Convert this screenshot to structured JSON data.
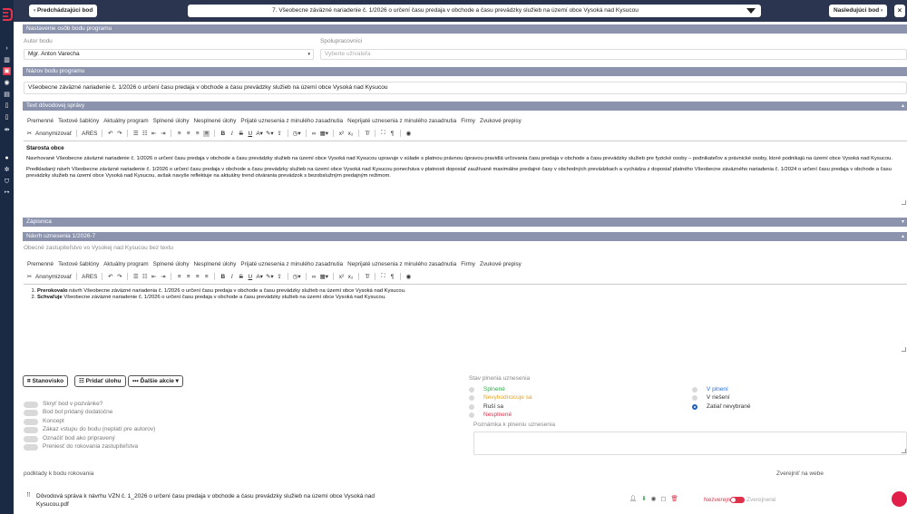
{
  "colors": {
    "sidebar_bg": "#1b2a44",
    "topbar_bg": "#2b3550",
    "section_header": "#8b93ad",
    "accent_red": "#e8334a",
    "radio_selected": "#1f5fbf",
    "fulfilled_green": "#33a84a",
    "partial_orange": "#e6a326",
    "unfulfilled_red": "#e0304a",
    "pending_blue": "#2a6fdb"
  },
  "topbar": {
    "prev_label": "‹ Predchádzajúci bod",
    "title": "7. Všeobecne záväzné nariadenie č. 1/2026 o určení času predaja v obchode a času prevádzky služieb na území obce Vysoká nad Kysucou",
    "next_label": "Nasledujúci bod ›",
    "close_label": "×"
  },
  "sidebar": {
    "icons": [
      "chevron-right-icon",
      "table-icon",
      "users-icon",
      "eye-icon",
      "calendar-icon",
      "document-icon",
      "document-icon",
      "bar-chart-icon",
      "people-icon",
      "user-icon",
      "gear-icon",
      "shield-icon",
      "logout-icon"
    ]
  },
  "settings": {
    "header": "Nastavenie osôb bodu programu",
    "author_label": "Autor bodu",
    "author_value": "Mgr. Anton Varecha",
    "collab_label": "Spolupracovníci",
    "collab_placeholder": "Vyberte užívateľa"
  },
  "name_section": {
    "header": "Názov bodu programu",
    "value": "Všeobecne záväzné nariadenie č. 1/2026 o určení času predaja v obchode a času prevádzky služieb na území obce Vysoká nad Kysucou"
  },
  "editor_menu": [
    "Premenné",
    "Textové šablóny",
    "Aktuálny program",
    "Splnené úlohy",
    "Nesplnené úlohy",
    "Prijaté uznesenia z minulého zasadnutia",
    "Neprijaté uznesenia z minulého zasadnutia",
    "Firmy",
    "Zvukové prepisy"
  ],
  "editor_toolbar": {
    "anonymize": "Anonymizovať",
    "ares": "ARES"
  },
  "report": {
    "header": "Text dôvodovej správy",
    "heading": "Starosta obce",
    "p1": "Navrhované Všeobecne záväzné nariadenie č. 1/2026 o určení času predaja v obchode a času prevádzky služieb na území obce Vysoká nad Kysucou upravuje v súlade s platnou právnou úpravou pravidlá určovania času predaja v obchode a času prevádzky služieb pre fyzické osoby – podnikateľov a právnické osoby, ktoré podnikajú na území obce Vysoká nad Kysucou.",
    "p2": "Predkladaný návrh Všeobecne záväzné nariadenie č. 1/2026 o určení času predaja v obchode a času prevádzky služieb na území obce Vysoká nad Kysucou ponecháva v platnosti doposiaľ zaužívané maximálne predajné časy v obchodných prevádzkach a vychádza z doposiaľ platného Všeobecne záväzného nariadenia č. 1/2024 o určení času predaja v obchode a času prevádzky služieb na území obce Vysoká nad Kysucou, avšak navyše reflektuje na aktuálny trend otvárania prevádzok s bezobslužným predajným režimom."
  },
  "minutes": {
    "header": "Zápisnica"
  },
  "resolution": {
    "header": "Návrh uznesenia 1/2026-7",
    "subtitle": "Obecné zastupiteľstvo vo Vysokej nad Kysucou bez textu",
    "item1_bold": "Prerokovalo",
    "item1_rest": " návrh Všeobecne záväzné nariadenia č. 1/2026 o určení času predaja v obchode a času prevádzky služieb na území obce Vysoká nad Kysucou.",
    "item2_bold": "Schvaľuje",
    "item2_rest": " Všeobecne záväzné nariadenie č. 1/2026 o určení času predaja v obchode a času prevádzky služieb na území obce Vysoká nad Kysucou."
  },
  "actions": {
    "position": "Stanovisko",
    "add_task": "Pridať úlohu",
    "more": "Ďalšie akcie"
  },
  "toggles": [
    "Skryť bod v pozvánke?",
    "Bod bol pridaný dodatočne",
    "Koncept",
    "Zákaz vstupu do bodu (neplatí pre autorov)",
    "Označiť bod ako pripravený",
    "Preniesť do rokovania zastupiteľstva"
  ],
  "status": {
    "label": "Stav plnenia uznesenia",
    "left": [
      "Splnené",
      "Nevyhodnocuje sa",
      "Ruší sa",
      "Nesplnené"
    ],
    "right": [
      "V plnení",
      "V riešení",
      "Zatiaľ nevybrané"
    ],
    "note_label": "Poznámka k plneniu uznesenia"
  },
  "attachments": {
    "label": "podklady k bodu rokovania",
    "publish_label": "Zverejniť na webe",
    "file_name": "Dôvodová správa k návrhu VZN č. 1_2026 o určení času predaja v obchode a času prevádzky služieb na území obce Vysoká nad Kysucou.pdf",
    "toggle_off": "Nezverejnené",
    "toggle_on": "Zverejnené"
  }
}
